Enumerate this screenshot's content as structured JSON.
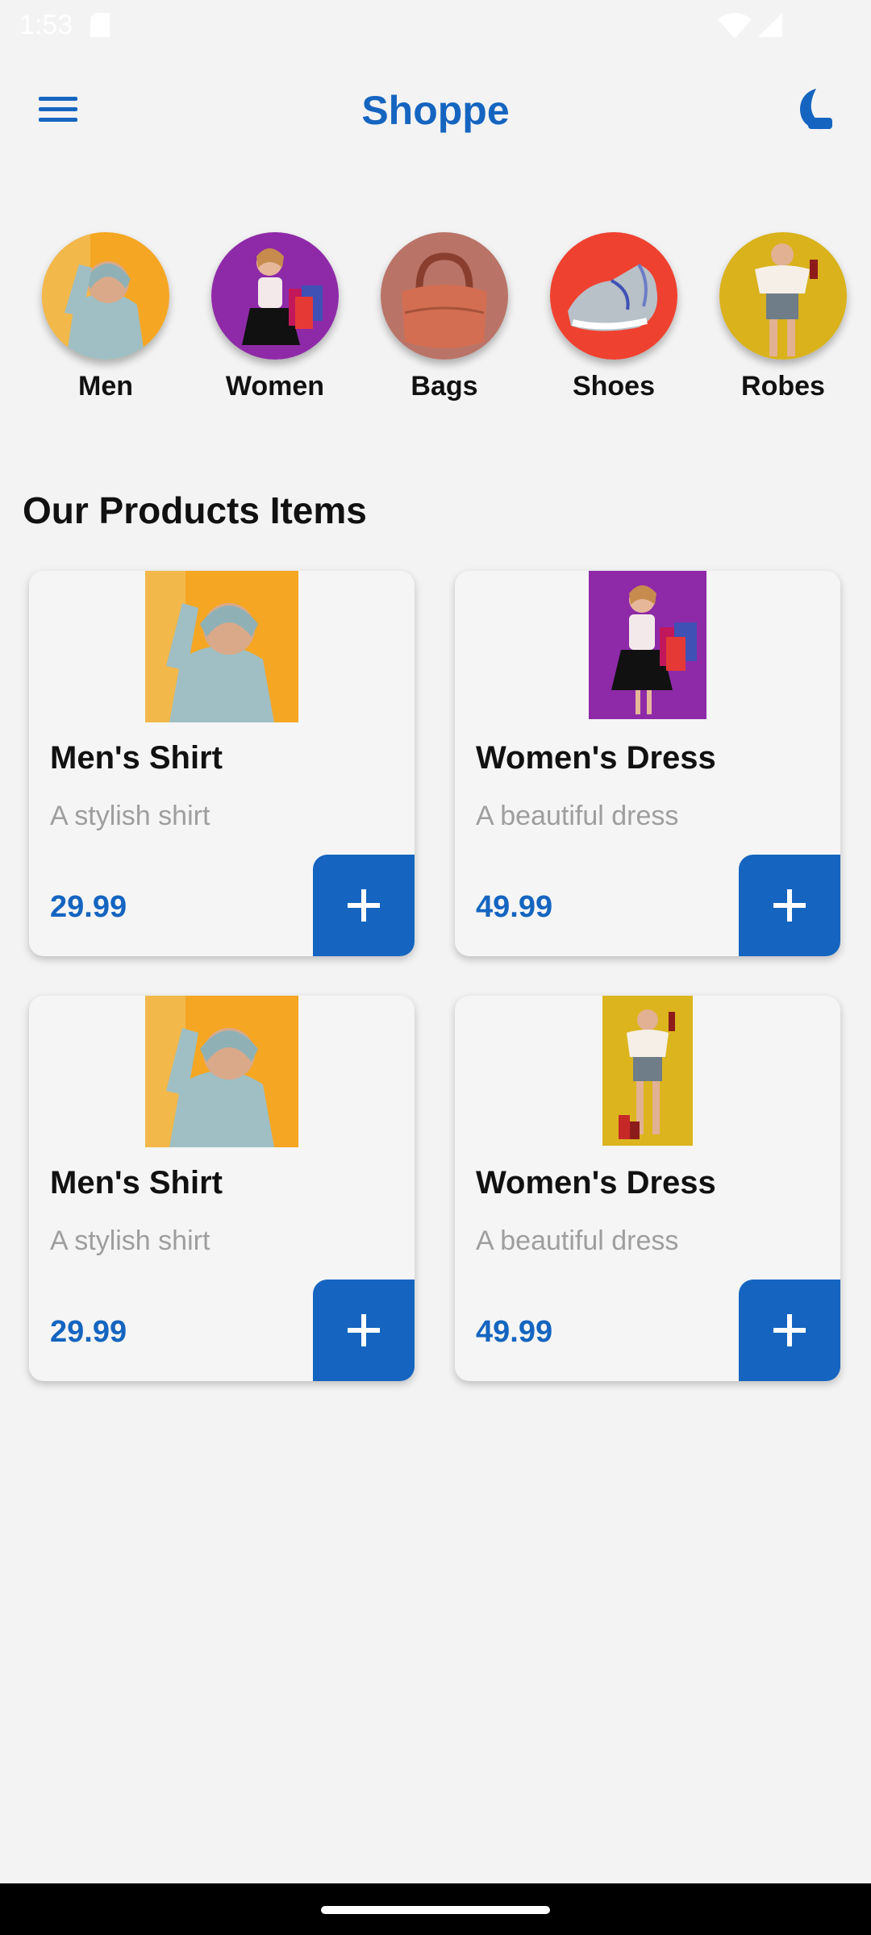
{
  "status_bar": {
    "time": "1:53"
  },
  "app_bar": {
    "title": "Shoppe",
    "menu_icon": "hamburger-menu-icon",
    "theme_icon": "moon-icon"
  },
  "categories": [
    {
      "label": "Men"
    },
    {
      "label": "Women"
    },
    {
      "label": "Bags"
    },
    {
      "label": "Shoes"
    },
    {
      "label": "Robes"
    }
  ],
  "section_title": "Our Products Items",
  "products": [
    {
      "name": "Men's Shirt",
      "description": "A stylish shirt",
      "price": "29.99"
    },
    {
      "name": "Women's Dress",
      "description": "A beautiful dress",
      "price": "49.99"
    },
    {
      "name": "Men's Shirt",
      "description": "A stylish shirt",
      "price": "29.99"
    },
    {
      "name": "Women's Dress",
      "description": "A beautiful dress",
      "price": "49.99"
    }
  ],
  "colors": {
    "accent": "#1565c0",
    "background": "#f3f3f3",
    "card": "#f5f5f5",
    "muted_text": "#9e9e9e"
  }
}
